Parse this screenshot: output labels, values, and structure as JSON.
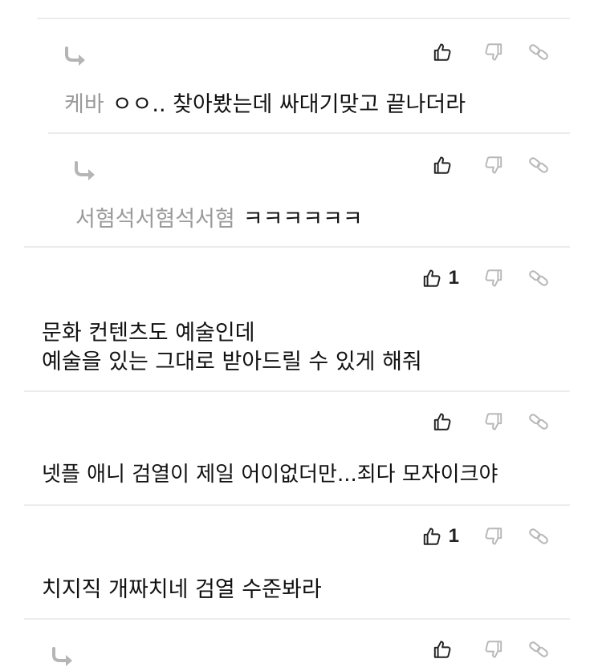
{
  "comments": [
    {
      "type": "reply",
      "nickname": "케바",
      "text": "ㅇㅇ.. 찾아봤는데 싸대기맞고 끝나더라",
      "likes": ""
    },
    {
      "type": "reply",
      "nickname": "서혐석서혐석서혐",
      "text": "ㅋㅋㅋㅋㅋㅋ",
      "likes": ""
    },
    {
      "type": "comment",
      "lines": [
        "문화 컨텐츠도 예술인데",
        "예술을 있는 그대로 받아드릴 수 있게 해줘"
      ],
      "likes": "1"
    },
    {
      "type": "comment",
      "lines": [
        "넷플 애니 검열이 제일 어이없더만...죄다 모자이크야"
      ],
      "likes": ""
    },
    {
      "type": "comment",
      "lines": [
        "치지직 개짜치네 검열 수준봐라"
      ],
      "likes": "1"
    },
    {
      "type": "reply",
      "nickname": "",
      "text": "",
      "likes": ""
    }
  ],
  "icons": {
    "like": "thumbs-up-icon",
    "dislike": "thumbs-down-icon",
    "link": "link-icon",
    "reply": "reply-arrow-icon"
  },
  "colors": {
    "text": "#111111",
    "nickname": "#9a9a9a",
    "divider": "#ececec",
    "icon_active": "#222222",
    "icon_inactive": "#b8b8b8"
  }
}
